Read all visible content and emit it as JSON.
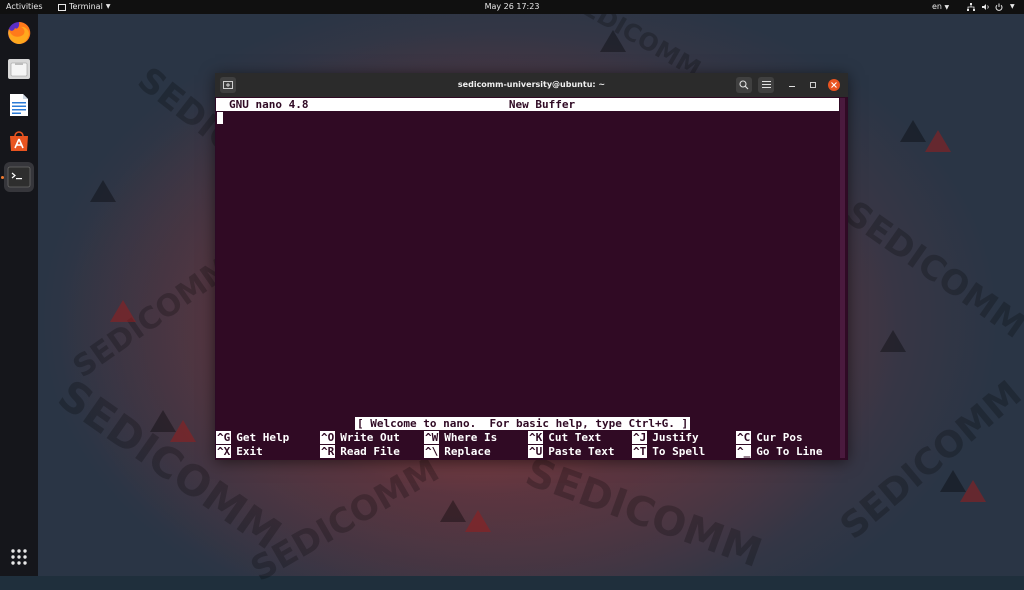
{
  "topbar": {
    "activities": "Activities",
    "app_menu": "Terminal",
    "clock": "May 26  17:23",
    "language": "en"
  },
  "dock": {
    "apps": [
      "firefox-icon",
      "files-icon",
      "writer-icon",
      "software-icon",
      "terminal-icon",
      "app-grid-icon"
    ]
  },
  "window": {
    "title": "sedicomm-university@ubuntu: ~"
  },
  "nano": {
    "version": "GNU nano 4.8",
    "buffer": "New Buffer",
    "status": "[ Welcome to nano.  For basic help, type Ctrl+G. ]",
    "shortcuts_row1": [
      {
        "key": "^G",
        "label": "Get Help"
      },
      {
        "key": "^O",
        "label": "Write Out"
      },
      {
        "key": "^W",
        "label": "Where Is"
      },
      {
        "key": "^K",
        "label": "Cut Text"
      },
      {
        "key": "^J",
        "label": "Justify"
      },
      {
        "key": "^C",
        "label": "Cur Pos"
      }
    ],
    "shortcuts_row2": [
      {
        "key": "^X",
        "label": "Exit"
      },
      {
        "key": "^R",
        "label": "Read File"
      },
      {
        "key": "^\\",
        "label": "Replace"
      },
      {
        "key": "^U",
        "label": "Paste Text"
      },
      {
        "key": "^T",
        "label": "To Spell"
      },
      {
        "key": "^_",
        "label": "Go To Line"
      }
    ]
  },
  "wallpaper": {
    "brand": "SEDICOMM"
  },
  "colors": {
    "terminal_bg": "#300a24",
    "titlebar_bg": "#2b2b2b",
    "close_btn": "#e95420"
  }
}
